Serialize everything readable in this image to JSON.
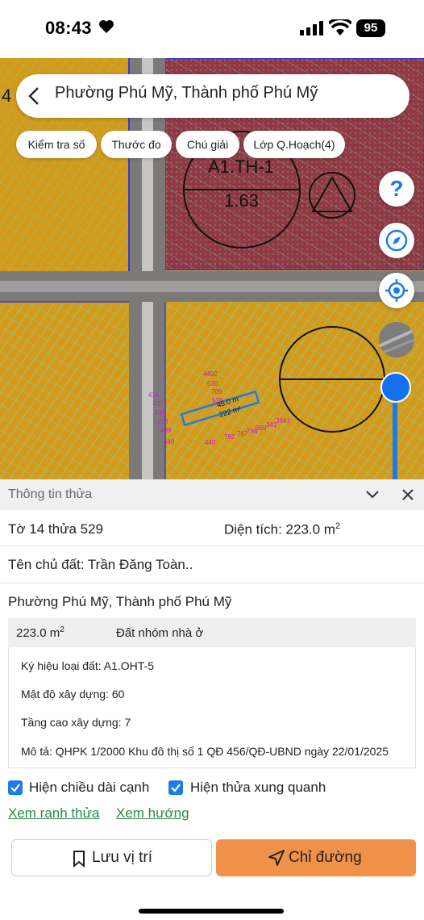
{
  "status_bar": {
    "time": "08:43",
    "battery": "95"
  },
  "header": {
    "title": "Phường Phú Mỹ, Thành phố Phú Mỹ"
  },
  "chips": [
    "Kiểm tra số",
    "Thước đo",
    "Chú giải",
    "Lớp Q.Hoạch(4)"
  ],
  "map": {
    "zone_code": "A1.TH-1",
    "zone_density": "1.63",
    "selected_length": "45.0 m",
    "selected_area": "222 m²",
    "parcel_labels": [
      "4492",
      "530",
      "709",
      "528",
      "414",
      "437",
      "436",
      "438",
      "439",
      "449",
      "440",
      "792",
      "767",
      "768",
      "669",
      "3341",
      "341",
      "4"
    ],
    "colors": {
      "residential": "#d59a1a",
      "commercial": "#8e3a44",
      "parcel_line": "#5fe0c8",
      "road": "#7c7a78",
      "selection": "#1e7be6"
    }
  },
  "panel": {
    "title": "Thông tin thửa",
    "sheet_parcel": "Tờ 14 thửa 529",
    "area_label": "Diện tích: 223.0 m",
    "area_sup": "2",
    "owner": "Tên chủ đất: Trần Đăng Toàn..",
    "address": "Phường Phú Mỹ, Thành phố Phú Mỹ",
    "zone": {
      "area": "223.0 m",
      "area_sup": "2",
      "type": "Đất nhóm nhà ở",
      "symbol": "Ký hiệu loại đất: A1.OHT-5",
      "density": "Mật độ xây dựng: 60",
      "floors": "Tầng cao xây dựng: 7",
      "description": "Mô tả: QHPK 1/2000 Khu đô thị số 1 QĐ 456/QĐ-UBND ngày 22/01/2025"
    },
    "checkbox_edge_length": "Hiện chiều dài cạnh",
    "checkbox_neighbors": "Hiện thửa xung quanh",
    "link_boundary": "Xem ranh thửa",
    "link_direction": "Xem hướng"
  },
  "actions": {
    "save": "Lưu vị trí",
    "directions": "Chỉ đường"
  }
}
